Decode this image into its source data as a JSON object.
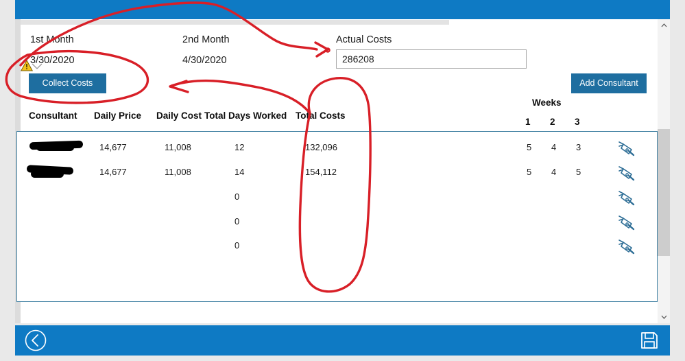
{
  "window": {
    "topbar_color": "#0e7ac4",
    "button_color": "#1e6ea0",
    "table_border_color": "#3c7ea0",
    "annotation_color": "#d81f27"
  },
  "form": {
    "month1_label": "1st Month",
    "month1_value": "3/30/2020",
    "month2_label": "2nd Month",
    "month2_value": "4/30/2020",
    "actual_costs_label": "Actual Costs",
    "actual_costs_value": "286208",
    "actual_costs_placeholder": "",
    "collect_costs_label": "Collect Costs",
    "add_consultant_label": "Add Consultant",
    "warning_icon": "warning-triangle-icon",
    "date_chevron_icon": "chevron-down-icon"
  },
  "table": {
    "weeks_group_label": "Weeks",
    "week_columns": [
      "1",
      "2",
      "3"
    ],
    "columns": [
      "Consultant",
      "Daily Price",
      "Daily Cost",
      "Total Days Worked",
      "Total Costs"
    ],
    "rows": [
      {
        "consultant": "",
        "redacted": true,
        "daily_price": "14,677",
        "daily_cost": "11,008",
        "total_days_worked": "12",
        "total_costs": "132,096",
        "weeks": [
          "5",
          "4",
          "3"
        ],
        "edit_icon": "pen-edit-icon"
      },
      {
        "consultant": "",
        "redacted": true,
        "daily_price": "14,677",
        "daily_cost": "11,008",
        "total_days_worked": "14",
        "total_costs": "154,112",
        "weeks": [
          "5",
          "4",
          "5"
        ],
        "edit_icon": "pen-edit-icon"
      },
      {
        "consultant": "",
        "redacted": false,
        "daily_price": "",
        "daily_cost": "",
        "total_days_worked": "0",
        "total_costs": "",
        "weeks": [
          "",
          "",
          ""
        ],
        "edit_icon": "pen-edit-icon"
      },
      {
        "consultant": "",
        "redacted": false,
        "daily_price": "",
        "daily_cost": "",
        "total_days_worked": "0",
        "total_costs": "",
        "weeks": [
          "",
          "",
          ""
        ],
        "edit_icon": "pen-edit-icon"
      },
      {
        "consultant": "",
        "redacted": false,
        "daily_price": "",
        "daily_cost": "",
        "total_days_worked": "0",
        "total_costs": "",
        "weeks": [
          "",
          "",
          ""
        ],
        "edit_icon": "pen-edit-icon"
      }
    ]
  },
  "footer": {
    "back_icon": "back-chevron-circle-icon",
    "save_icon": "save-floppy-icon"
  },
  "scrollbar": {
    "up_icon": "chevron-up-icon",
    "down_icon": "chevron-down-icon"
  }
}
